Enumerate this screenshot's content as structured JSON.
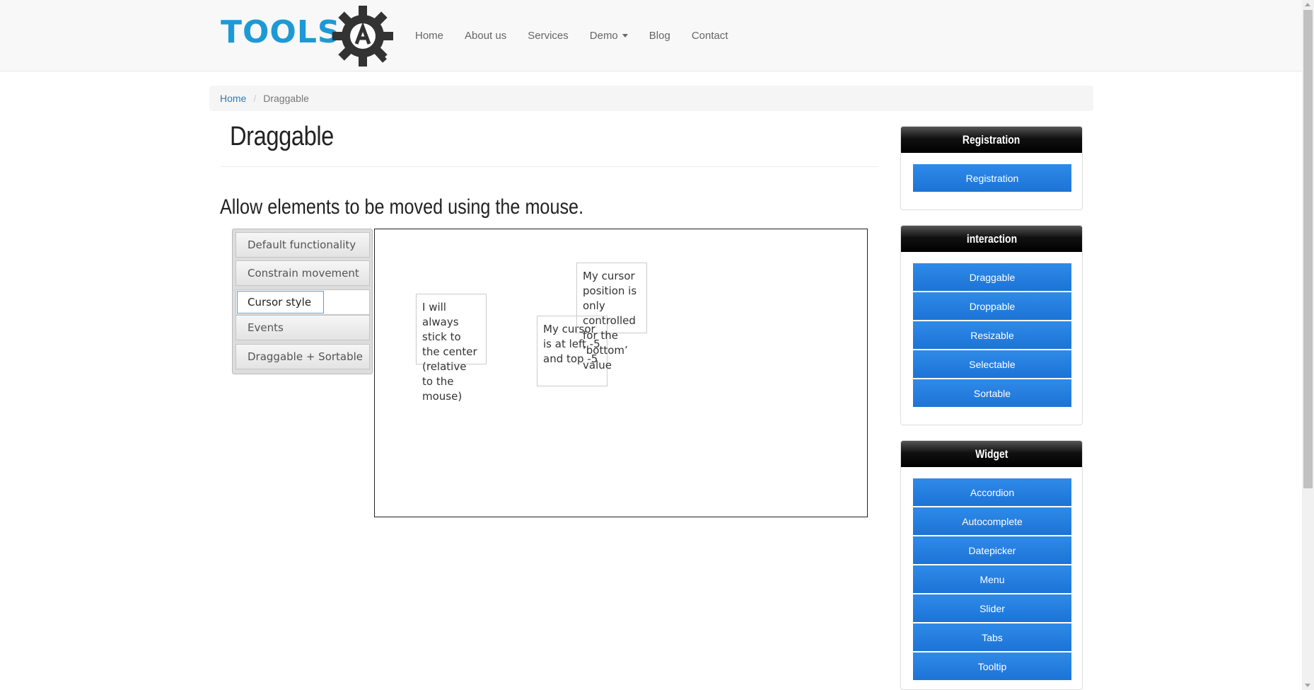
{
  "brand": {
    "logo_text": "TOOLS",
    "logo_icon": "gear-qa-icon",
    "accent": "#1d9ad6"
  },
  "nav": {
    "items": [
      "Home",
      "About us",
      "Services",
      "Demo",
      "Blog",
      "Contact"
    ]
  },
  "breadcrumb": {
    "home": "Home",
    "separator": "/",
    "current": "Draggable"
  },
  "page": {
    "title": "Draggable",
    "subtitle": "Allow elements to be moved using the mouse."
  },
  "tabs": {
    "items": [
      "Default functionality",
      "Constrain movement",
      "Cursor style",
      "Events",
      "Draggable + Sortable"
    ],
    "selected": "Cursor style"
  },
  "demo": {
    "box_center": "I will always stick to the center (relative to the mouse)",
    "box_lefttop": "My cursor is at left -5 and top -5",
    "box_bottom": "My cursor position is only controlled for the ‘bottom’ value"
  },
  "sidebar": {
    "registration": {
      "title": "Registration",
      "items": [
        "Registration"
      ]
    },
    "interaction": {
      "title": "interaction",
      "items": [
        "Draggable",
        "Droppable",
        "Resizable",
        "Selectable",
        "Sortable"
      ]
    },
    "widget": {
      "title": "Widget",
      "items": [
        "Accordion",
        "Autocomplete",
        "Datepicker",
        "Menu",
        "Slider",
        "Tabs",
        "Tooltip"
      ]
    }
  },
  "colors": {
    "button": "#1c74d6",
    "panel_head": "#000000",
    "link": "#337ab7"
  }
}
